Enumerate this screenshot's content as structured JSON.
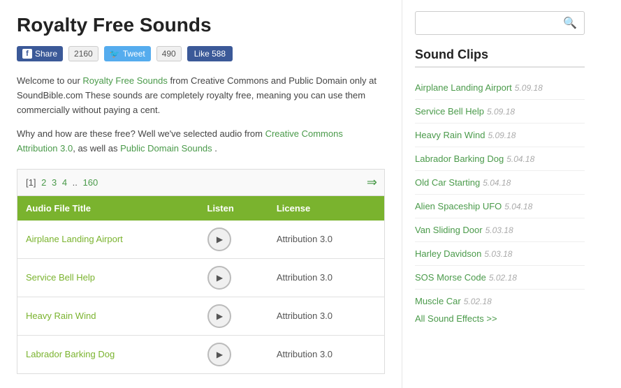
{
  "page": {
    "title": "Royalty Free Sounds",
    "intro1": "Welcome to our ",
    "intro_link1": "Royalty Free Sounds",
    "intro2": " from Creative Commons and Public Domain only at SoundBible.com These sounds are completely royalty free, meaning you can use them commercially without paying a cent.",
    "why1": "Why and how are these free? Well we've selected audio from ",
    "why_link1": "Creative Commons Attribution 3.0",
    "why2": ", as well as ",
    "why_link2": "Public Domain Sounds",
    "why3": " ."
  },
  "social": {
    "fb_label": "Share",
    "fb_count": "2160",
    "tw_label": "Tweet",
    "tw_count": "490",
    "li_label": "Like 588"
  },
  "pagination": {
    "current": "[1]",
    "pages": "2 3 4 ..160"
  },
  "table": {
    "headers": [
      "Audio File Title",
      "Listen",
      "License"
    ],
    "rows": [
      {
        "title": "Airplane Landing Airport",
        "license": "Attribution 3.0"
      },
      {
        "title": "Service Bell Help",
        "license": "Attribution 3.0"
      },
      {
        "title": "Heavy Rain Wind",
        "license": "Attribution 3.0"
      },
      {
        "title": "Labrador Barking Dog",
        "license": "Attribution 3.0"
      }
    ]
  },
  "sidebar": {
    "search_placeholder": "",
    "section_title": "Sound Clips",
    "clips": [
      {
        "title": "Airplane Landing Airport",
        "date": "5.09.18"
      },
      {
        "title": "Service Bell Help",
        "date": "5.09.18"
      },
      {
        "title": "Heavy Rain Wind",
        "date": "5.09.18"
      },
      {
        "title": "Labrador Barking Dog",
        "date": "5.04.18"
      },
      {
        "title": "Old Car Starting",
        "date": "5.04.18"
      },
      {
        "title": "Alien Spaceship UFO",
        "date": "5.04.18"
      },
      {
        "title": "Van Sliding Door",
        "date": "5.03.18"
      },
      {
        "title": "Harley Davidson",
        "date": "5.03.18"
      },
      {
        "title": "SOS Morse Code",
        "date": "5.02.18"
      },
      {
        "title": "Muscle Car",
        "date": "5.02.18"
      }
    ],
    "all_effects": "All Sound Effects >>"
  }
}
